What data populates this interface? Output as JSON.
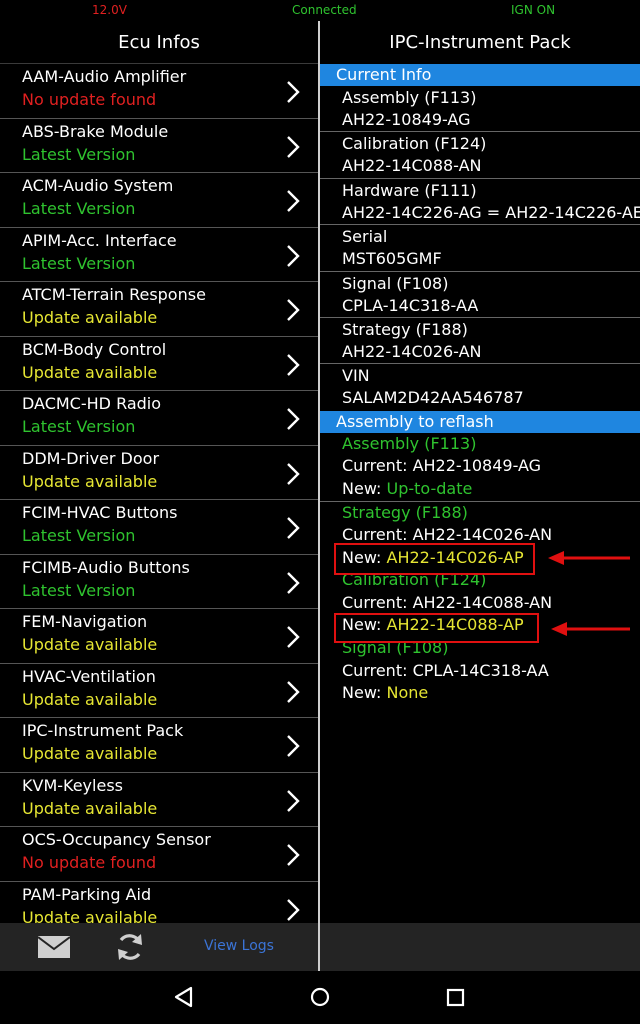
{
  "status": {
    "voltage": "12.0V",
    "connection": "Connected",
    "ignition": "IGN ON"
  },
  "left": {
    "title": "Ecu Infos",
    "items": [
      {
        "name": "AAM-Audio Amplifier",
        "status": "No update found",
        "color": "#e02020"
      },
      {
        "name": "ABS-Brake Module",
        "status": "Latest Version",
        "color": "#2fc32f"
      },
      {
        "name": "ACM-Audio System",
        "status": "Latest Version",
        "color": "#2fc32f"
      },
      {
        "name": "APIM-Acc. Interface",
        "status": "Latest Version",
        "color": "#2fc32f"
      },
      {
        "name": "ATCM-Terrain Response",
        "status": "Update available",
        "color": "#e6e633"
      },
      {
        "name": "BCM-Body Control",
        "status": "Update available",
        "color": "#e6e633"
      },
      {
        "name": "DACMC-HD Radio",
        "status": "Latest Version",
        "color": "#2fc32f"
      },
      {
        "name": "DDM-Driver Door",
        "status": "Update available",
        "color": "#e6e633"
      },
      {
        "name": "FCIM-HVAC Buttons",
        "status": "Latest Version",
        "color": "#2fc32f"
      },
      {
        "name": "FCIMB-Audio Buttons",
        "status": "Latest Version",
        "color": "#2fc32f"
      },
      {
        "name": "FEM-Navigation",
        "status": "Update available",
        "color": "#e6e633"
      },
      {
        "name": "HVAC-Ventilation",
        "status": "Update available",
        "color": "#e6e633"
      },
      {
        "name": "IPC-Instrument Pack",
        "status": "Update available",
        "color": "#e6e633"
      },
      {
        "name": "KVM-Keyless",
        "status": "Update available",
        "color": "#e6e633"
      },
      {
        "name": "OCS-Occupancy Sensor",
        "status": "No update found",
        "color": "#e02020"
      },
      {
        "name": "PAM-Parking Aid",
        "status": "Update available",
        "color": "#e6e633"
      }
    ],
    "view_logs": "View Logs"
  },
  "right": {
    "title": "IPC-Instrument Pack",
    "current_info_header": "Current Info",
    "current_info": [
      {
        "label": "Assembly (F113)",
        "value": "AH22-10849-AG"
      },
      {
        "label": "Calibration (F124)",
        "value": "AH22-14C088-AN"
      },
      {
        "label": "Hardware (F111)",
        "value": "AH22-14C226-AG = AH22-14C226-AE"
      },
      {
        "label": "Serial",
        "value": "MST605GMF"
      },
      {
        "label": "Signal (F108)",
        "value": "CPLA-14C318-AA"
      },
      {
        "label": "Strategy (F188)",
        "value": "AH22-14C026-AN"
      },
      {
        "label": "VIN",
        "value": "SALAM2D42AA546787"
      }
    ],
    "reflash_header": "Assembly to reflash",
    "reflash": [
      {
        "label": "Assembly (F113)",
        "current_prefix": "Current: ",
        "current": "AH22-10849-AG",
        "new_prefix": "New: ",
        "new": "Up-to-date"
      },
      {
        "label": "Strategy (F188)",
        "current_prefix": "Current: ",
        "current": "AH22-14C026-AN",
        "new_prefix": "New: ",
        "new": "AH22-14C026-AP"
      },
      {
        "label": "Calibration (F124)",
        "current_prefix": "Current: ",
        "current": "AH22-14C088-AN",
        "new_prefix": "New: ",
        "new": "AH22-14C088-AP"
      },
      {
        "label": "Signal (F108)",
        "current_prefix": "Current: ",
        "current": "CPLA-14C318-AA",
        "new_prefix": "New: ",
        "new": "None"
      }
    ]
  },
  "colors": {
    "accent": "#1f86e0",
    "green": "#2fc32f",
    "yellow": "#e6e633",
    "red": "#e02020",
    "annotation": "#e01010"
  }
}
